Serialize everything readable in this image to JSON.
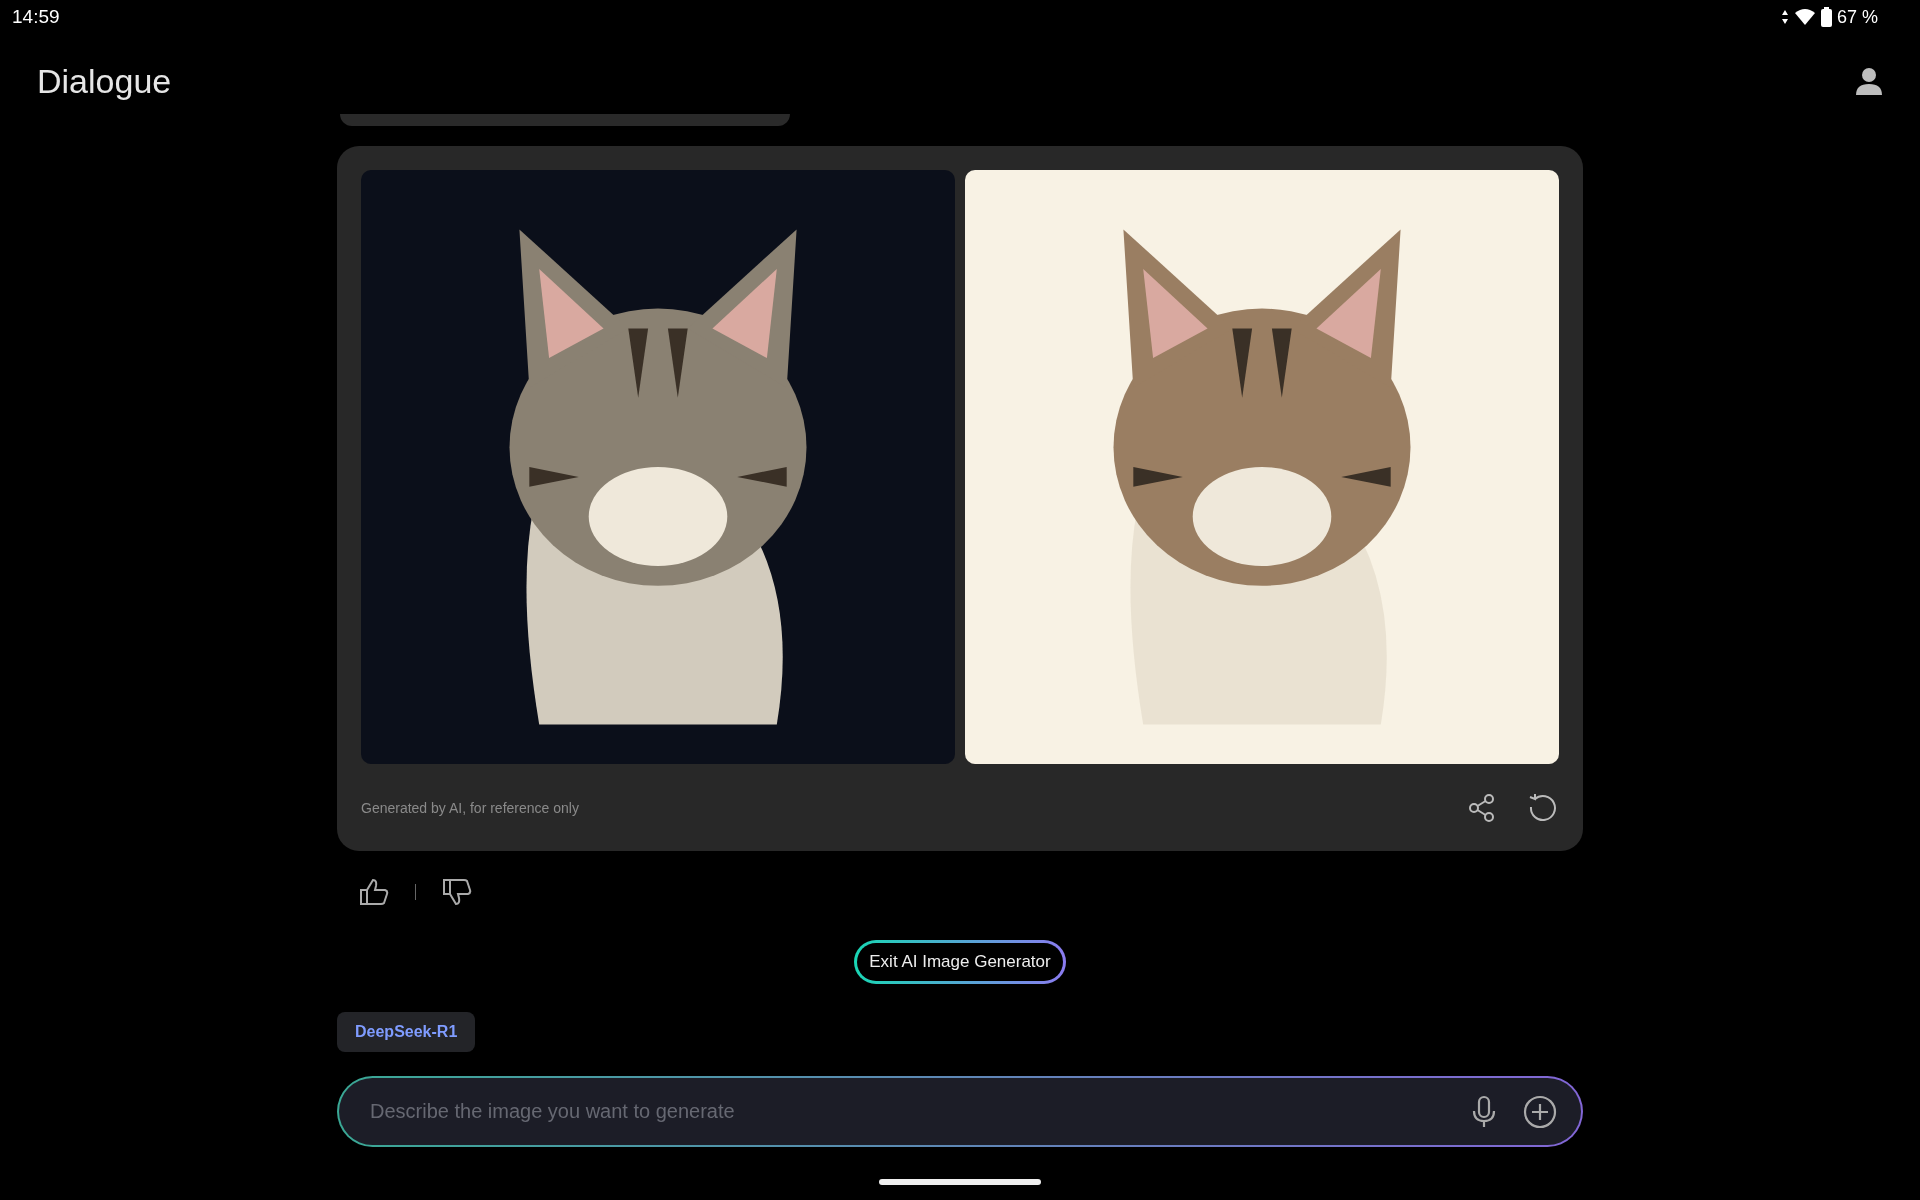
{
  "status_bar": {
    "time": "14:59",
    "battery": "67 %"
  },
  "header": {
    "title": "Dialogue"
  },
  "image_card": {
    "caption": "Generated by AI, for reference only"
  },
  "exit_button": {
    "label": "Exit AI Image Generator"
  },
  "model_tag": {
    "label": "DeepSeek-R1"
  },
  "input": {
    "placeholder": "Describe the image you want to generate"
  }
}
